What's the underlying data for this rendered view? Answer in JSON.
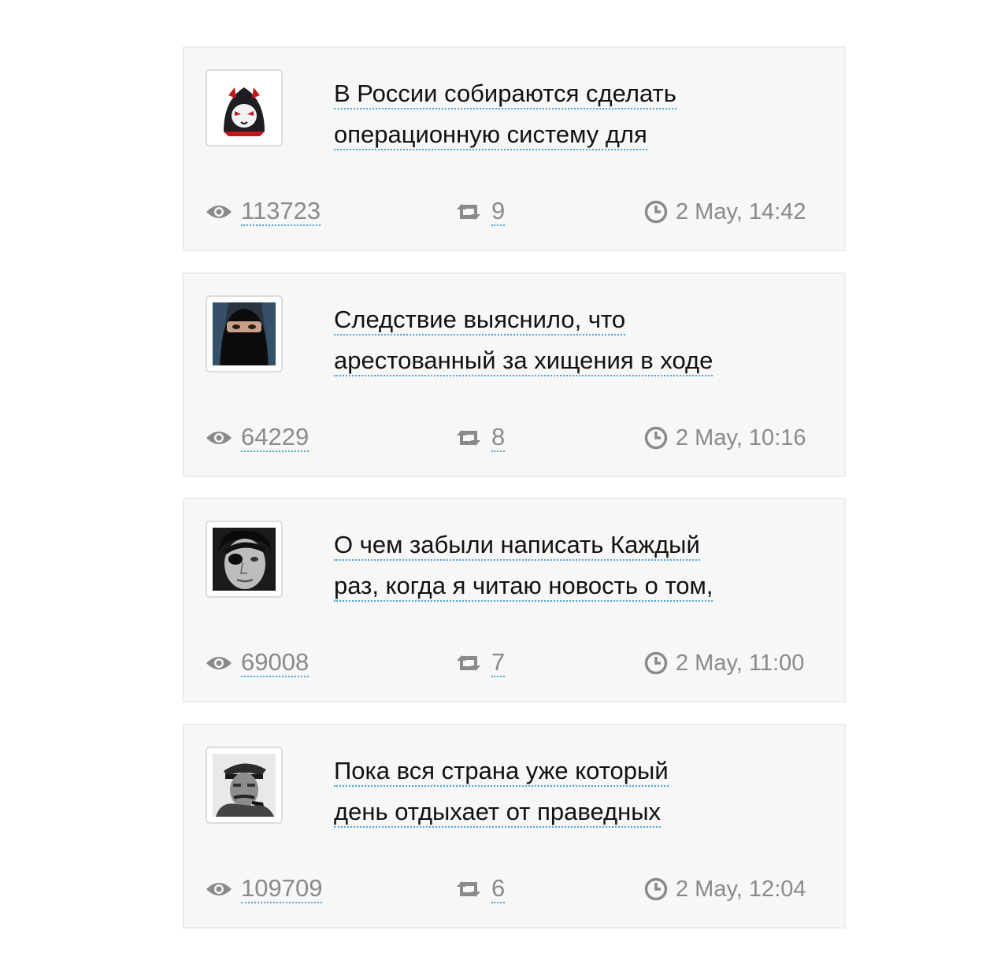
{
  "posts": [
    {
      "avatar": "hooded-cat-avatar",
      "title_line1": "В России собираются сделать",
      "title_line2": "операционную систему для",
      "views": "113723",
      "reposts": "9",
      "time": "2 May, 14:42"
    },
    {
      "avatar": "masked-face-avatar",
      "title_line1": "Следствие выяснило, что",
      "title_line2": "арестованный за хищения в ходе",
      "views": "64229",
      "reposts": "8",
      "time": "2 May, 10:16"
    },
    {
      "avatar": "eyepatch-man-avatar",
      "title_line1": "О чем забыли написать Каждый",
      "title_line2": "раз, когда я читаю новость о том,",
      "views": "69008",
      "reposts": "7",
      "time": "2 May, 11:00"
    },
    {
      "avatar": "cap-pipe-man-avatar",
      "title_line1": "Пока вся страна уже который",
      "title_line2": "день отдыхает от праведных",
      "views": "109709",
      "reposts": "6",
      "time": "2 May, 12:04"
    }
  ],
  "colors": {
    "card_bg": "#f7f7f7",
    "link_underline": "#4aa3df",
    "meta_text": "#8a8a8a",
    "title_text": "#111111"
  },
  "icons": {
    "views": "eye-icon",
    "reposts": "repost-icon",
    "time": "clock-icon"
  }
}
